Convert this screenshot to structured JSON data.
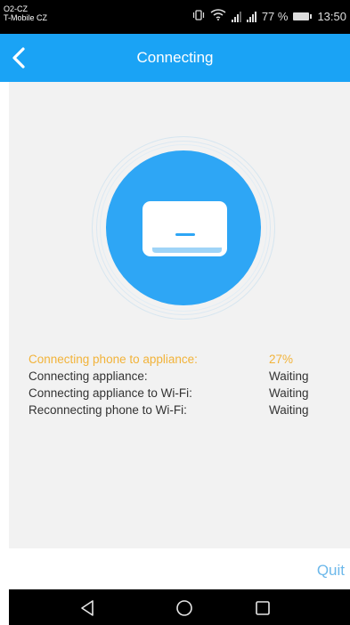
{
  "status_bar": {
    "carrier_line1": "O2-CZ",
    "carrier_line2": "T-Mobile CZ",
    "battery_text": "77 %",
    "time": "13:50"
  },
  "header": {
    "title": "Connecting",
    "back_icon": "chevron-left-icon"
  },
  "steps": [
    {
      "label": "Connecting phone to appliance:",
      "value": "27%",
      "state": "active"
    },
    {
      "label": "Connecting appliance:",
      "value": "Waiting",
      "state": "waiting"
    },
    {
      "label": "Connecting appliance to Wi-Fi:",
      "value": "Waiting",
      "state": "waiting"
    },
    {
      "label": "Reconnecting phone to Wi-Fi:",
      "value": "Waiting",
      "state": "waiting"
    }
  ],
  "footer": {
    "quit_label": "Quit"
  },
  "colors": {
    "accent": "#1aa3f5",
    "active_text": "#f2b33a",
    "quit_text": "#6cb8ea"
  }
}
